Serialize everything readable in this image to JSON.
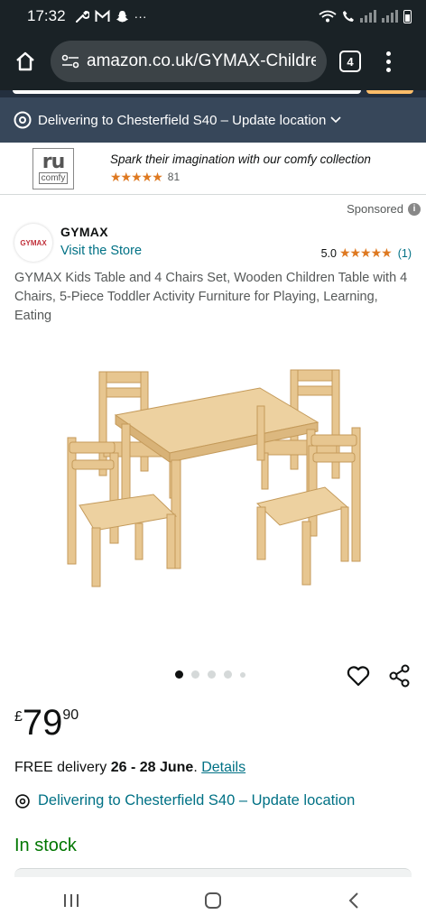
{
  "status_bar": {
    "time": "17:32",
    "notification_icons": [
      "wrench-icon",
      "gmail-icon",
      "snapchat-icon",
      "more-icon"
    ],
    "more": "···"
  },
  "browser": {
    "url": "amazon.co.uk/GYMAX-Childrer",
    "tab_count": "4"
  },
  "delivery_bar": {
    "text": "Delivering to Chesterfield S40 – Update location"
  },
  "sponsor_banner": {
    "logo_main": "ru",
    "logo_sub": "comfy",
    "tagline": "Spark their imagination with our comfy collection",
    "stars": "★★★★★",
    "rating_count": "81"
  },
  "sponsored": {
    "label": "Sponsored",
    "info": "i"
  },
  "brand": {
    "logo_text": "GYMAX",
    "name": "GYMAX",
    "visit_store": "Visit the Store",
    "rating_value": "5.0",
    "stars": "★★★★★",
    "rating_count": "(1)"
  },
  "product": {
    "title": "GYMAX Kids Table and 4 Chairs Set, Wooden Children Table with 4 Chairs, 5-Piece Toddler Activity Furniture for Playing, Learning, Eating",
    "image_count": 5,
    "active_image_index": 0
  },
  "price": {
    "currency": "£",
    "whole": "79",
    "fraction": "90"
  },
  "delivery": {
    "prefix": "FREE delivery ",
    "dates": "26 - 28 June",
    "suffix": ". ",
    "details_link": "Details"
  },
  "location": {
    "text": "Delivering to Chesterfield S40 – Update location"
  },
  "stock": {
    "status": "In stock"
  },
  "colors": {
    "link": "#007185",
    "in_stock": "#007600",
    "star": "#de7921",
    "header_dark": "#1a2226",
    "delivery_bar": "#37475a"
  }
}
